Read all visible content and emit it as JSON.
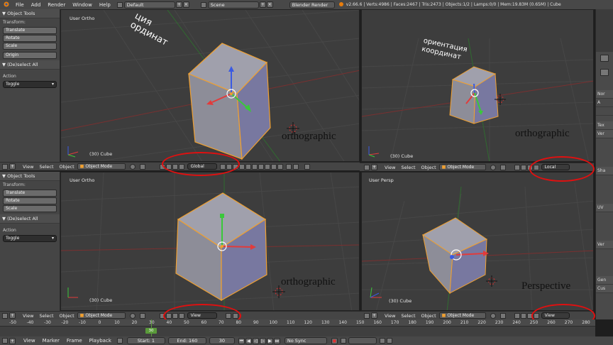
{
  "topbar": {
    "menus": [
      "File",
      "Add",
      "Render",
      "Window",
      "Help"
    ],
    "screen_layout": "Default",
    "scene": "Scene",
    "render_engine": "Blender Render",
    "stats": "v2.66.6 | Verts:4986 | Faces:2467 | Tris:2473 | Objects:1/2 | Lamps:0/0 | Mem:19.83M (0.65M) | Cube"
  },
  "toolpanel": {
    "header": "Object Tools",
    "transform_label": "Transform:",
    "buttons": [
      "Translate",
      "Rotate",
      "Scale"
    ],
    "origin_btn": "Origin",
    "deselect_header": "(De)select All",
    "action_label": "Action",
    "action_value": "Toggle"
  },
  "viewports": [
    {
      "title": "User Ortho",
      "object_label": "(30) Cube",
      "annotation": "orthographic",
      "orientation": "Global",
      "overlay_text": "ция\nординат"
    },
    {
      "title": "",
      "object_label": "(30) Cube",
      "annotation": "orthographic",
      "orientation": "Local",
      "overlay_text": "ориентация\nкоординат"
    },
    {
      "title": "User Ortho",
      "object_label": "(30) Cube",
      "annotation": "orthographic",
      "orientation": "View"
    },
    {
      "title": "User Persp",
      "object_label": "(30) Cube",
      "annotation": "Perspective",
      "orientation": "View"
    }
  ],
  "vp_footer": {
    "menus": [
      "View",
      "Select",
      "Object"
    ],
    "mode": "Object Mode"
  },
  "right_panel": {
    "rows": [
      "Nor",
      "A",
      "",
      "Tex",
      "Ver",
      "Sha",
      "UV",
      "Ver",
      "Gen",
      "Cus"
    ]
  },
  "timeline": {
    "ticks": [
      "-50",
      "-40",
      "-30",
      "-20",
      "-10",
      "0",
      "10",
      "20",
      "30",
      "40",
      "50",
      "60",
      "70",
      "80",
      "90",
      "100",
      "110",
      "120",
      "130",
      "140",
      "150",
      "160",
      "170",
      "180",
      "190",
      "200",
      "210",
      "220",
      "230",
      "240",
      "250",
      "260",
      "270",
      "280"
    ],
    "current_frame_marker": "30",
    "menus": [
      "View",
      "Marker",
      "Frame",
      "Playback"
    ],
    "start": "Start: 1",
    "end": "End: 160",
    "frame": "30",
    "sync": "No Sync"
  },
  "colors": {
    "highlight_ellipse": "#e01010",
    "axis_x": "#e23b3b",
    "axis_y": "#3ac83a",
    "axis_z": "#3a5ae2",
    "cube_front": "#8c8c9c",
    "cube_outline": "#f0a030"
  }
}
